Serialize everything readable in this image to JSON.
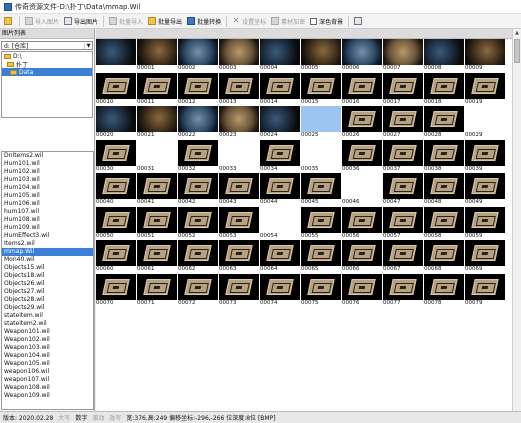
{
  "window": {
    "title": "传奇资源文件-D:\\扑丁\\Data\\mmap.Wil"
  },
  "toolbar": {
    "open_label": "",
    "import_label": "导入图片",
    "export_label": "导出图片",
    "batch_import_label": "批量导入",
    "batch_export_label": "批量导出",
    "batch_convert_label": "批量转换",
    "set_coords_label": "设置坐标",
    "material_add_label": "素材加密",
    "dark_bg_label": "深色背景"
  },
  "left": {
    "panel_title": "图片列表",
    "drive": "d: [仓库]",
    "folders": [
      {
        "label": "D:\\",
        "selected": false
      },
      {
        "label": "扑丁",
        "selected": false
      },
      {
        "label": "Data",
        "selected": true
      }
    ],
    "files": [
      {
        "label": "DnItems2.wil",
        "selected": false
      },
      {
        "label": "Hum101.wil",
        "selected": false
      },
      {
        "label": "Hum102.wil",
        "selected": false
      },
      {
        "label": "Hum103.wil",
        "selected": false
      },
      {
        "label": "Hum104.wil",
        "selected": false
      },
      {
        "label": "Hum105.wil",
        "selected": false
      },
      {
        "label": "Hum106.wil",
        "selected": false
      },
      {
        "label": "hum107.wil",
        "selected": false
      },
      {
        "label": "Hum108.wil",
        "selected": false
      },
      {
        "label": "Hum109.wil",
        "selected": false
      },
      {
        "label": "HumEffect3.wil",
        "selected": false
      },
      {
        "label": "Items2.wil",
        "selected": false
      },
      {
        "label": "mmap.Wil",
        "selected": true
      },
      {
        "label": "Mon40.wil",
        "selected": false
      },
      {
        "label": "Objects15.wil",
        "selected": false
      },
      {
        "label": "Objects18.wil",
        "selected": false
      },
      {
        "label": "Objects26.wil",
        "selected": false
      },
      {
        "label": "Objects27.wil",
        "selected": false
      },
      {
        "label": "Objects28.wil",
        "selected": false
      },
      {
        "label": "Objects29.wil",
        "selected": false
      },
      {
        "label": "stateitem.wil",
        "selected": false
      },
      {
        "label": "stateitem2.wil",
        "selected": false
      },
      {
        "label": "Weapon101.wil",
        "selected": false
      },
      {
        "label": "Weapon102.wil",
        "selected": false
      },
      {
        "label": "Weapon103.wil",
        "selected": false
      },
      {
        "label": "Weapon104.wil",
        "selected": false
      },
      {
        "label": "Weapon105.wil",
        "selected": false
      },
      {
        "label": "weapon106.wil",
        "selected": false
      },
      {
        "label": "weapon107.wil",
        "selected": false
      },
      {
        "label": "Weapon108.wil",
        "selected": false
      },
      {
        "label": "Weapon109.wil",
        "selected": false
      }
    ]
  },
  "grid": {
    "labels": [
      "00001",
      "00002",
      "00003",
      "00004",
      "00005",
      "00006",
      "00007",
      "00008",
      "00009",
      "00010",
      "00011",
      "00012",
      "00013",
      "00014",
      "00015",
      "00016",
      "00017",
      "00018",
      "00019",
      "00020",
      "00021",
      "00022",
      "00023",
      "00024",
      "00025",
      "00026",
      "00027",
      "00028",
      "00029",
      "00030",
      "00031",
      "00032",
      "00033",
      "00034",
      "00035",
      "00036",
      "00037",
      "00038",
      "00039",
      "00040",
      "00041",
      "00042",
      "00043",
      "00044",
      "00045",
      "00046",
      "00047",
      "00048",
      "00049",
      "00050",
      "00051",
      "00052",
      "00053",
      "00054",
      "00055",
      "00056",
      "00057",
      "00058",
      "00059",
      "00060",
      "00061",
      "00062",
      "00063",
      "00064",
      "00065",
      "00066",
      "00067",
      "00068",
      "00069",
      "00070",
      "00071",
      "00072",
      "00073",
      "00074",
      "00075",
      "00076",
      "00077",
      "00078",
      "00079"
    ],
    "selected_label": "00025"
  },
  "status": {
    "version": "版本: 2020.02.28",
    "caps": "大写",
    "num": "数字",
    "scroll": "滚动",
    "insert": "改写",
    "info": "宽:376,高:249 偏移坐标:-296,-266 位深度:8位 [BMP]"
  }
}
